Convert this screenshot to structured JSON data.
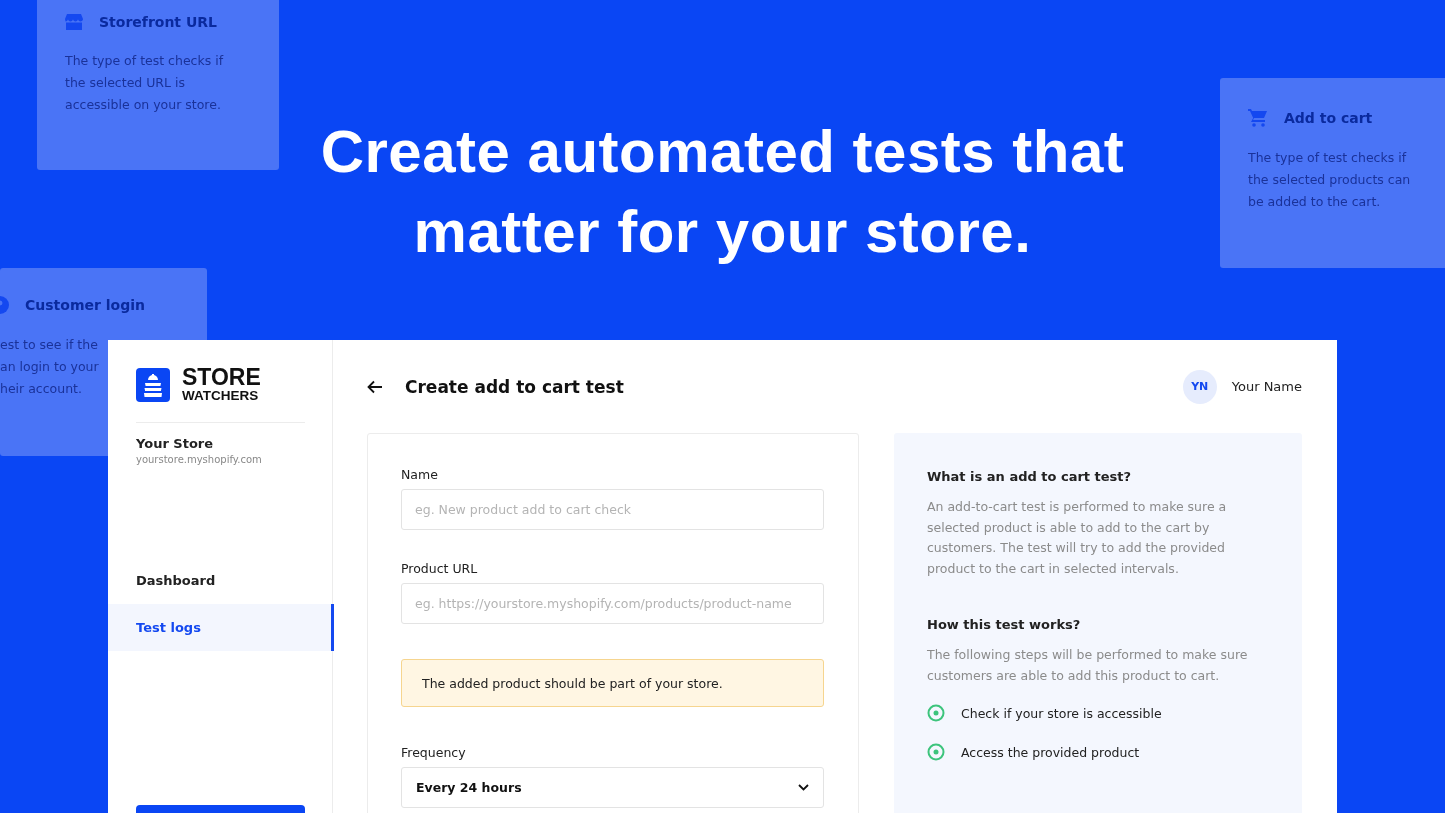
{
  "hero": {
    "title_lines": [
      "Create automated tests that",
      "matter for your store."
    ]
  },
  "feature_cards": [
    {
      "kind": "storefront",
      "title": "Storefront URL",
      "lines": [
        "The type of test checks if",
        "the selected URL is",
        "accessible on your store."
      ]
    },
    {
      "kind": "cart",
      "title": "Add to cart",
      "lines": [
        "The type of test checks if",
        "the selected products can",
        "be added to the cart."
      ]
    },
    {
      "kind": "login",
      "title": "Customer login",
      "lines": [
        "est to see if the",
        "an login to your",
        "heir account."
      ]
    }
  ],
  "sidebar": {
    "logo": {
      "line1": "STORE",
      "line2": "WATCHERS"
    },
    "store_name": "Your Store",
    "store_url": "yourstore.myshopify.com",
    "items": [
      {
        "label": "Dashboard",
        "selected": false
      },
      {
        "label": "Test logs",
        "selected": true
      }
    ]
  },
  "header": {
    "title": "Create add to cart test",
    "user": {
      "initials": "YN",
      "name": "Your Name"
    }
  },
  "form": {
    "fields": [
      {
        "kind": "text",
        "label": "Name",
        "placeholder": "eg. New product add to cart check"
      },
      {
        "kind": "text",
        "label": "Product URL",
        "placeholder": "eg. https://yourstore.myshopify.com/products/product-name"
      },
      {
        "kind": "notice",
        "text": "The added product should be part of your store."
      },
      {
        "kind": "select",
        "label": "Frequency",
        "value": "Every 24 hours"
      }
    ]
  },
  "info": {
    "sections": [
      {
        "heading": "What is an add to cart test?",
        "body": "An add-to-cart test is performed to make sure a selected product is able to add to the cart by customers. The test will try to add the provided product to the cart in selected intervals."
      },
      {
        "heading": "How this test works?",
        "body": "The following steps will be performed to make sure customers are able to add this product to cart."
      }
    ],
    "steps": [
      "Check if your store is accessible",
      "Access the provided product"
    ]
  }
}
